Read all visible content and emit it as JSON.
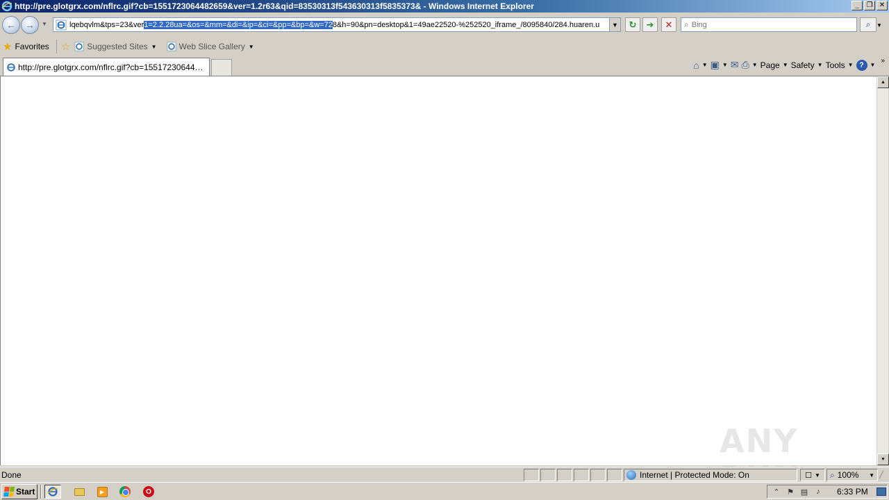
{
  "window": {
    "title": "http://pre.glotgrx.com/nflrc.gif?cb=1551723064482659&ver=1.2r63&qid=83530313f543630313f5835373& - Windows Internet Explorer",
    "min": "0",
    "max": "1",
    "close": "r"
  },
  "address": {
    "url_before": "lqebqvlm&tps=23&ver",
    "url_selected": "1=2.2.28ua=&os=&mm=&di=&ip=&ci=&pp=&bp=&w=72",
    "url_after": "8&h=90&pn=desktop&1=49ae22520-%252520_iframe_/8095840/284.huaren.u"
  },
  "search": {
    "placeholder": "Bing"
  },
  "favorites_bar": {
    "favorites_label": "Favorites",
    "items": [
      {
        "label": "Suggested Sites"
      },
      {
        "label": "Web Slice Gallery"
      }
    ]
  },
  "tabs": [
    {
      "label": "http://pre.glotgrx.com/nflrc.gif?cb=15517230644826..."
    }
  ],
  "command_bar": {
    "page": "Page",
    "safety": "Safety",
    "tools": "Tools",
    "help": "?"
  },
  "content": {
    "watermark": "ANY RUN"
  },
  "status_bar": {
    "status": "Done",
    "zone": "Internet | Protected Mode: On",
    "zoom": "100%"
  },
  "taskbar": {
    "start_label": "Start",
    "clock": "6:33 PM"
  },
  "colors": {
    "titlebar_start": "#0a246a",
    "selection": "#316ac5",
    "chrome": "#d4d0c8"
  }
}
